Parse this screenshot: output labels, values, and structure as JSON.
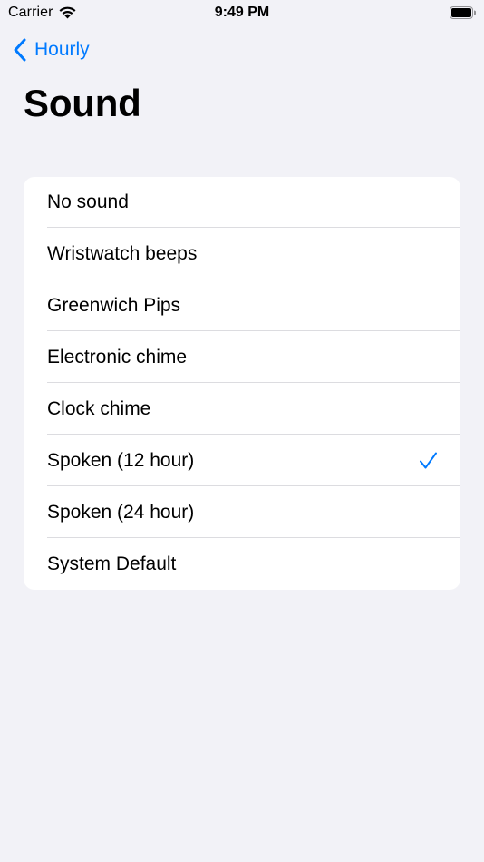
{
  "status_bar": {
    "carrier": "Carrier",
    "time": "9:49 PM",
    "wifi_icon": "wifi-icon",
    "battery_icon": "battery-icon",
    "battery_level": 1.0
  },
  "nav": {
    "back_label": "Hourly",
    "back_icon": "chevron-left-icon",
    "title": "Sound"
  },
  "options": [
    {
      "label": "No sound",
      "selected": false
    },
    {
      "label": "Wristwatch beeps",
      "selected": false
    },
    {
      "label": "Greenwich Pips",
      "selected": false
    },
    {
      "label": "Electronic chime",
      "selected": false
    },
    {
      "label": "Clock chime",
      "selected": false
    },
    {
      "label": "Spoken (12 hour)",
      "selected": true
    },
    {
      "label": "Spoken (24 hour)",
      "selected": false
    },
    {
      "label": "System Default",
      "selected": false
    }
  ],
  "colors": {
    "accent": "#007aff",
    "background": "#f2f2f7",
    "card": "#ffffff"
  }
}
